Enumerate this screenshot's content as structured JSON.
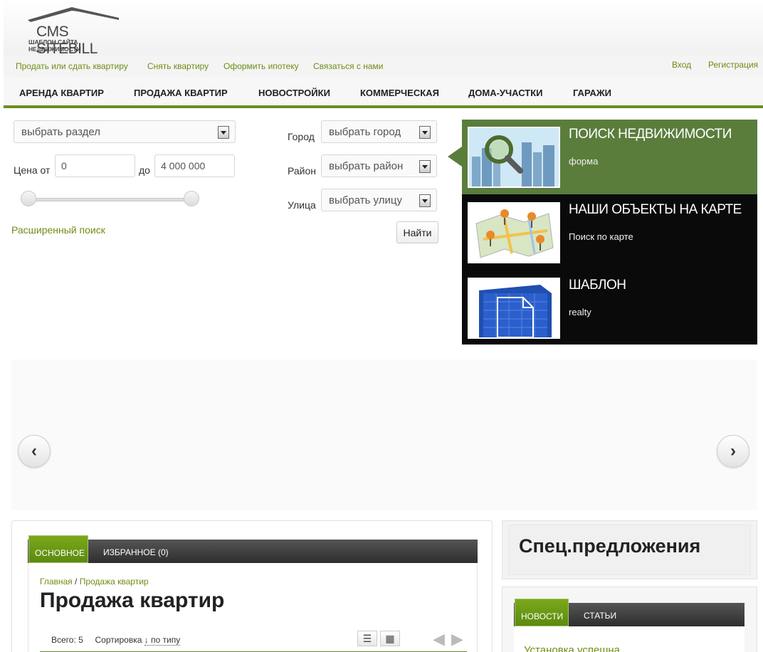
{
  "logo": {
    "name": "CMS SITEBILL",
    "tagline": "ШАБЛОН САЙТА НЕДВИЖИМОСТИ"
  },
  "toplinks": {
    "items": [
      "Продать или сдать квартиру",
      "Снять квартиру",
      "Оформить ипотеку",
      "Связаться с нами"
    ],
    "login": "Вход",
    "register": "Регистрация"
  },
  "nav": [
    "АРЕНДА КВАРТИР",
    "ПРОДАЖА КВАРТИР",
    "НОВОСТРОЙКИ",
    "КОММЕРЧЕСКАЯ",
    "ДОМА-УЧАСТКИ",
    "ГАРАЖИ"
  ],
  "search": {
    "section_select": "выбрать раздел",
    "price_from_label": "Цена от",
    "price_from": "0",
    "price_to_label": "до",
    "price_to": "4 000 000",
    "advanced_link": "Расширенный поиск",
    "city_label": "Город",
    "city_select": "выбрать город",
    "district_label": "Район",
    "district_select": "выбрать район",
    "street_label": "Улица",
    "street_select": "выбрать улицу",
    "find_button": "Найти"
  },
  "panel": [
    {
      "title": "ПОИСК НЕДВИЖИМОСТИ",
      "subtitle": "форма",
      "icon": "city-search-icon"
    },
    {
      "title": "НАШИ ОБЪЕКТЫ НА КАРТЕ",
      "subtitle": "Поиск по карте",
      "icon": "map-pins-icon"
    },
    {
      "title": "ШАБЛОН",
      "subtitle": "realty",
      "icon": "blueprint-icon"
    }
  ],
  "carousel": {
    "prev": "‹",
    "next": "›"
  },
  "content": {
    "tab_main": "ОСНОВНОЕ",
    "tab_favorites": "ИЗБРАННОЕ (0)",
    "breadcrumb_home": "Главная",
    "breadcrumb_sep": "/",
    "breadcrumb_current": "Продажа квартир",
    "title": "Продажа квартир",
    "total_label": "Всего:",
    "total": "5",
    "sort_label": "Сортировка",
    "sort_value": "↓ по типу"
  },
  "sidebar": {
    "spec_title": "Спец.предложения",
    "news_tab": "НОВОСТИ",
    "articles_tab": "СТАТЬИ",
    "news_item": "Установка успешна"
  },
  "colors": {
    "accent_green": "#6b8e1f",
    "link_green": "#6f8c15",
    "panel_active": "#5a7d3c",
    "panel_bg": "#0a0a0a"
  }
}
